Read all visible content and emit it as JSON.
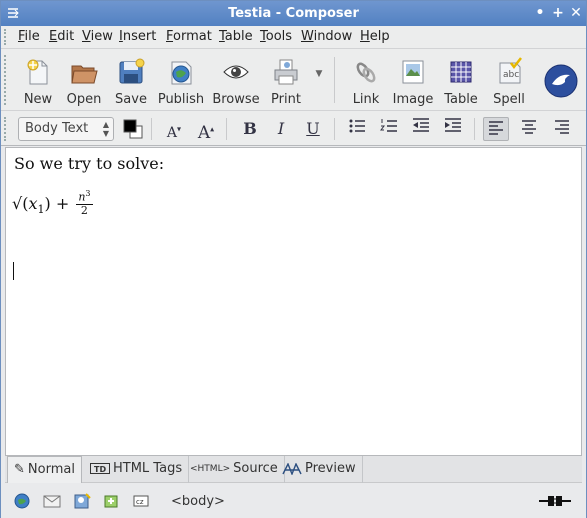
{
  "window": {
    "title": "Testia - Composer",
    "minimize": "•",
    "maximize": "+",
    "close": "✕"
  },
  "menu": [
    {
      "label": "File",
      "ul": "F",
      "rest": "ile"
    },
    {
      "label": "Edit",
      "ul": "E",
      "rest": "dit"
    },
    {
      "label": "View",
      "ul": "V",
      "rest": "iew"
    },
    {
      "label": "Insert",
      "ul": "I",
      "rest": "nsert"
    },
    {
      "label": "Format",
      "ul": "F",
      "rest": "ormat"
    },
    {
      "label": "Table",
      "ul": "T",
      "rest": "able"
    },
    {
      "label": "Tools",
      "ul": "T",
      "rest": "ools"
    },
    {
      "label": "Window",
      "ul": "W",
      "rest": "indow"
    },
    {
      "label": "Help",
      "ul": "H",
      "rest": "elp"
    }
  ],
  "toolbar": {
    "new": "New",
    "open": "Open",
    "save": "Save",
    "publish": "Publish",
    "browse": "Browse",
    "print": "Print",
    "link": "Link",
    "image": "Image",
    "table": "Table",
    "spell": "Spell"
  },
  "format": {
    "paragraph_style": "Body Text",
    "bold": "B",
    "italic": "I",
    "underline": "U"
  },
  "editor": {
    "paragraph": "So we try to solve:",
    "math": {
      "radicand_var": "x",
      "radicand_sub": "1",
      "plus": "+",
      "num_var": "n",
      "num_exp": "3",
      "den": "2"
    }
  },
  "tabs": {
    "normal": "Normal",
    "html_tags": "HTML Tags",
    "source": "Source",
    "preview": "Preview"
  },
  "status": {
    "breadcrumb": "<body>"
  },
  "colors": {
    "titlebar": "#5a87c6",
    "accent": "#3a6fb5"
  }
}
